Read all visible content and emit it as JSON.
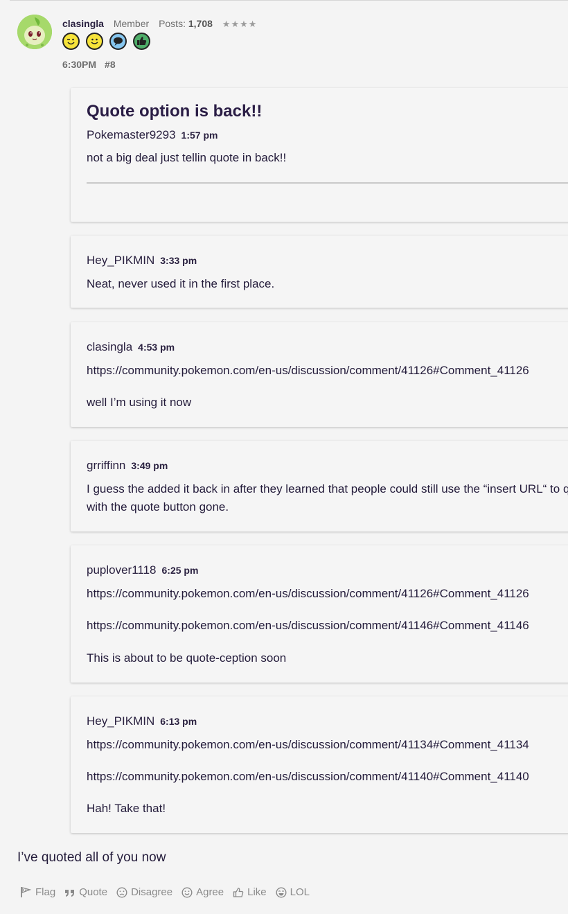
{
  "post": {
    "author": "clasingla",
    "role": "Member",
    "posts_label": "Posts:",
    "posts_count": "1,708",
    "stars": "★★★★",
    "time": "6:30PM",
    "number": "#8",
    "badges": [
      "wink-emoji-icon",
      "smile-emoji-icon",
      "speech-bubble-icon",
      "thumbs-up-icon"
    ]
  },
  "quotes": [
    {
      "title": "Quote option is back!!",
      "user": "Pokemaster9293",
      "time": "1:57 pm",
      "lines": [
        "not a big deal just tellin quote in back!!"
      ]
    },
    {
      "user": "Hey_PIKMIN",
      "time": "3:33 pm",
      "lines": [
        "Neat, never used it in the first place."
      ]
    },
    {
      "user": "clasingla",
      "time": "4:53 pm",
      "lines": [
        "https://community.pokemon.com/en-us/discussion/comment/41126#Comment_41126",
        "well I’m using it now"
      ]
    },
    {
      "user": "grriffinn",
      "time": "3:49 pm",
      "lines": [
        "I guess the added it back in after they learned that people could still use the “insert URL“ to quote with the quote button gone.",
        "with the quote button gone."
      ]
    },
    {
      "user": "puplover1118",
      "time": "6:25 pm",
      "lines": [
        "https://community.pokemon.com/en-us/discussion/comment/41126#Comment_41126",
        "https://community.pokemon.com/en-us/discussion/comment/41146#Comment_41146",
        "This is about to be quote-ception soon"
      ]
    },
    {
      "user": "Hey_PIKMIN",
      "time": "6:13 pm",
      "lines": [
        "https://community.pokemon.com/en-us/discussion/comment/41134#Comment_41134",
        "https://community.pokemon.com/en-us/discussion/comment/41140#Comment_41140",
        "Hah! Take that!"
      ]
    }
  ],
  "body_text": "I’ve quoted all of you now",
  "actions": {
    "flag": "Flag",
    "quote": "Quote",
    "disagree": "Disagree",
    "agree": "Agree",
    "like": "Like",
    "lol": "LOL"
  },
  "colors": {
    "background": "#f4f4f4",
    "text": "#231b3a",
    "muted": "#8a8a8a"
  }
}
